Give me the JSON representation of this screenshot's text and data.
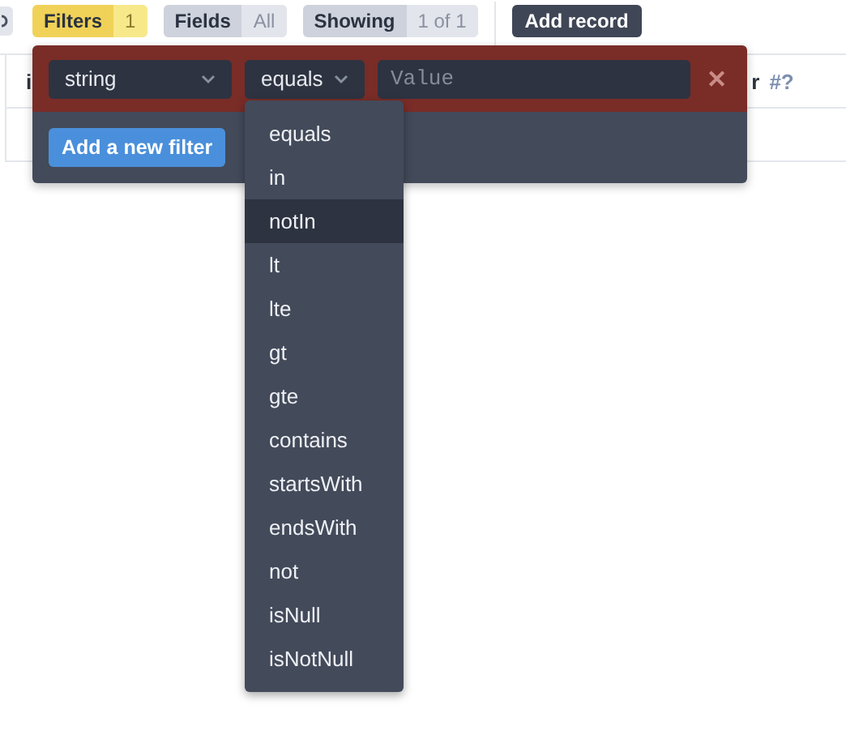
{
  "toolbar": {
    "filters": {
      "label": "Filters",
      "count": "1"
    },
    "fields": {
      "label": "Fields",
      "value": "All"
    },
    "showing": {
      "label": "Showing",
      "value": "1 of 1"
    },
    "add_record": "Add record"
  },
  "table": {
    "header": {
      "column_1": "i",
      "column_2": "r",
      "column_2_type": "#?"
    }
  },
  "filter_panel": {
    "field": "string",
    "operator": "equals",
    "value_placeholder": "Value",
    "remove": "✕",
    "add_filter": "Add a new filter"
  },
  "operator_menu": [
    {
      "label": "equals",
      "selected": false
    },
    {
      "label": "in",
      "selected": false
    },
    {
      "label": "notIn",
      "selected": true
    },
    {
      "label": "lt",
      "selected": false
    },
    {
      "label": "lte",
      "selected": false
    },
    {
      "label": "gt",
      "selected": false
    },
    {
      "label": "gte",
      "selected": false
    },
    {
      "label": "contains",
      "selected": false
    },
    {
      "label": "startsWith",
      "selected": false
    },
    {
      "label": "endsWith",
      "selected": false
    },
    {
      "label": "not",
      "selected": false
    },
    {
      "label": "isNull",
      "selected": false
    },
    {
      "label": "isNotNull",
      "selected": false
    }
  ]
}
